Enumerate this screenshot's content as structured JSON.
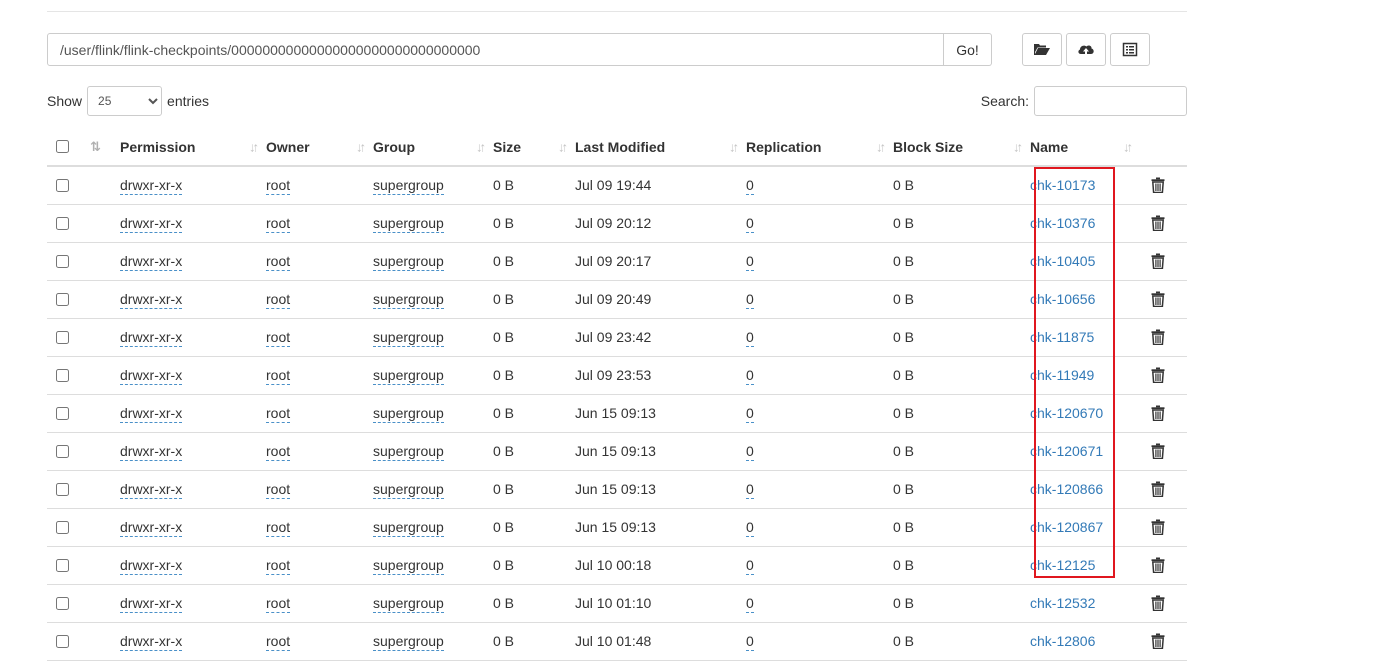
{
  "path_bar": {
    "path_value": "/user/flink/flink-checkpoints/00000000000000000000000000000000",
    "go_label": "Go!"
  },
  "toolbar": {
    "icons": [
      "folder-open-icon",
      "cloud-upload-icon",
      "list-icon"
    ]
  },
  "length": {
    "show_label": "Show",
    "selected": "25",
    "entries_label": "entries"
  },
  "search": {
    "label": "Search:",
    "value": ""
  },
  "table": {
    "columns": [
      "Permission",
      "Owner",
      "Group",
      "Size",
      "Last Modified",
      "Replication",
      "Block Size",
      "Name"
    ],
    "rows": [
      {
        "permission": "drwxr-xr-x",
        "owner": "root",
        "group": "supergroup",
        "size": "0 B",
        "modified": "Jul 09 19:44",
        "replication": "0",
        "block_size": "0 B",
        "name": "chk-10173"
      },
      {
        "permission": "drwxr-xr-x",
        "owner": "root",
        "group": "supergroup",
        "size": "0 B",
        "modified": "Jul 09 20:12",
        "replication": "0",
        "block_size": "0 B",
        "name": "chk-10376"
      },
      {
        "permission": "drwxr-xr-x",
        "owner": "root",
        "group": "supergroup",
        "size": "0 B",
        "modified": "Jul 09 20:17",
        "replication": "0",
        "block_size": "0 B",
        "name": "chk-10405"
      },
      {
        "permission": "drwxr-xr-x",
        "owner": "root",
        "group": "supergroup",
        "size": "0 B",
        "modified": "Jul 09 20:49",
        "replication": "0",
        "block_size": "0 B",
        "name": "chk-10656"
      },
      {
        "permission": "drwxr-xr-x",
        "owner": "root",
        "group": "supergroup",
        "size": "0 B",
        "modified": "Jul 09 23:42",
        "replication": "0",
        "block_size": "0 B",
        "name": "chk-11875"
      },
      {
        "permission": "drwxr-xr-x",
        "owner": "root",
        "group": "supergroup",
        "size": "0 B",
        "modified": "Jul 09 23:53",
        "replication": "0",
        "block_size": "0 B",
        "name": "chk-11949"
      },
      {
        "permission": "drwxr-xr-x",
        "owner": "root",
        "group": "supergroup",
        "size": "0 B",
        "modified": "Jun 15 09:13",
        "replication": "0",
        "block_size": "0 B",
        "name": "chk-120670"
      },
      {
        "permission": "drwxr-xr-x",
        "owner": "root",
        "group": "supergroup",
        "size": "0 B",
        "modified": "Jun 15 09:13",
        "replication": "0",
        "block_size": "0 B",
        "name": "chk-120671"
      },
      {
        "permission": "drwxr-xr-x",
        "owner": "root",
        "group": "supergroup",
        "size": "0 B",
        "modified": "Jun 15 09:13",
        "replication": "0",
        "block_size": "0 B",
        "name": "chk-120866"
      },
      {
        "permission": "drwxr-xr-x",
        "owner": "root",
        "group": "supergroup",
        "size": "0 B",
        "modified": "Jun 15 09:13",
        "replication": "0",
        "block_size": "0 B",
        "name": "chk-120867"
      },
      {
        "permission": "drwxr-xr-x",
        "owner": "root",
        "group": "supergroup",
        "size": "0 B",
        "modified": "Jul 10 00:18",
        "replication": "0",
        "block_size": "0 B",
        "name": "chk-12125"
      },
      {
        "permission": "drwxr-xr-x",
        "owner": "root",
        "group": "supergroup",
        "size": "0 B",
        "modified": "Jul 10 01:10",
        "replication": "0",
        "block_size": "0 B",
        "name": "chk-12532"
      },
      {
        "permission": "drwxr-xr-x",
        "owner": "root",
        "group": "supergroup",
        "size": "0 B",
        "modified": "Jul 10 01:48",
        "replication": "0",
        "block_size": "0 B",
        "name": "chk-12806"
      }
    ]
  },
  "colors": {
    "link": "#337ab7",
    "highlight_border": "#e0171f",
    "dotted_underline": "#4a90c8"
  }
}
